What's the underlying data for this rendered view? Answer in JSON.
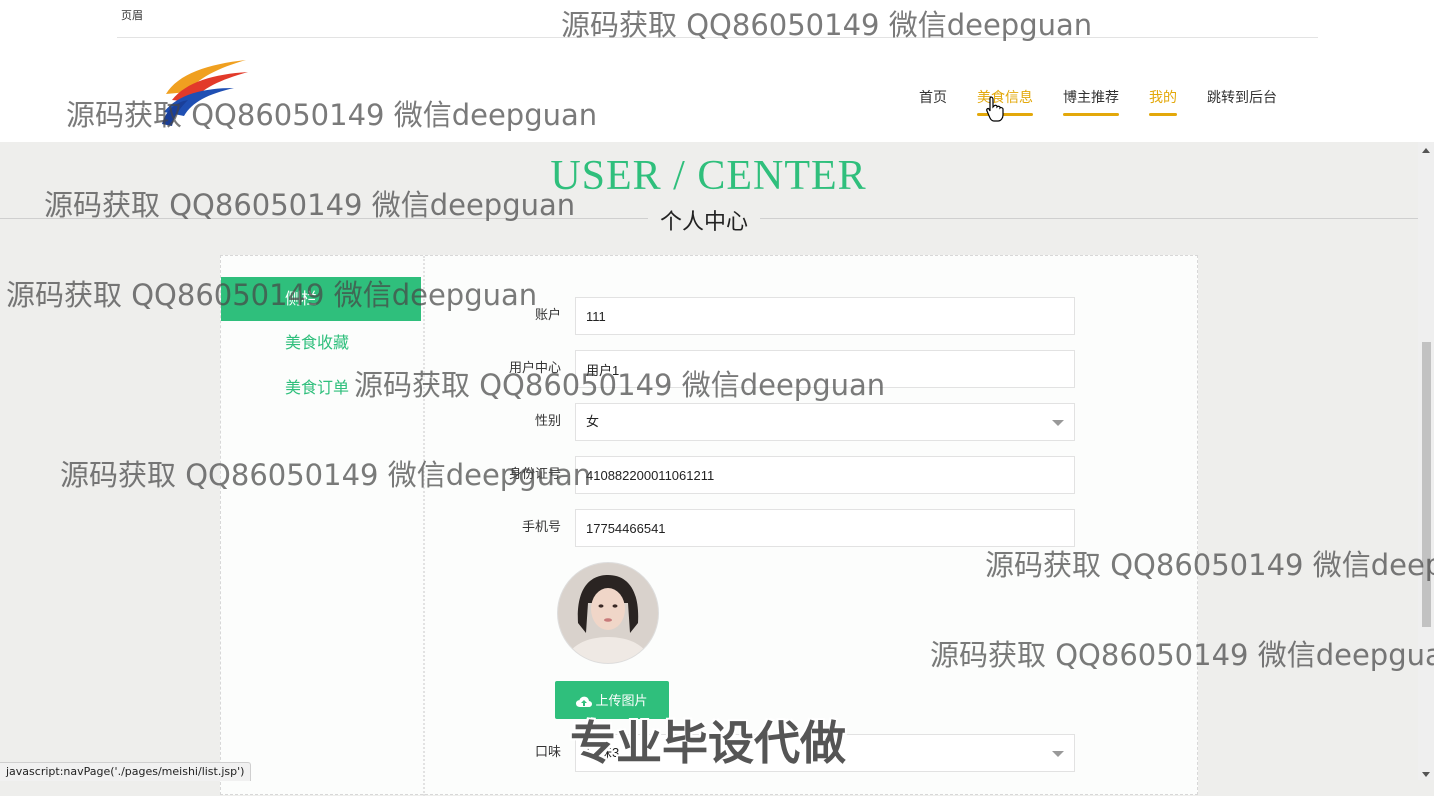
{
  "header": {
    "welcome_text": "页眉",
    "nav": [
      {
        "label": "首页"
      },
      {
        "label": "美食信息"
      },
      {
        "label": "博主推荐"
      },
      {
        "label": "我的"
      },
      {
        "label": "跳转到后台"
      }
    ],
    "accent_color": "#e3a80a"
  },
  "page": {
    "title_en": "USER / CENTER",
    "title_cn": "个人中心",
    "primary_color": "#2fbf7c"
  },
  "sidebar": {
    "items": [
      {
        "label": "侧栏"
      },
      {
        "label": "美食收藏"
      },
      {
        "label": "美食订单"
      }
    ]
  },
  "form": {
    "account": {
      "label": "账户",
      "value": "111"
    },
    "name": {
      "label": "用户中心",
      "value": "用户1"
    },
    "gender": {
      "label": "性别",
      "value": "女"
    },
    "id_card": {
      "label": "身份证号",
      "value": "410882200011061211"
    },
    "phone": {
      "label": "手机号",
      "value": "17754466541"
    },
    "upload_label": "上传图片",
    "taste": {
      "label": "口味",
      "value": "口味3"
    }
  },
  "status_bar": {
    "text": "javascript:navPage('./pages/meishi/list.jsp')"
  },
  "watermarks": {
    "text": "源码获取 QQ86050149 微信deepguan",
    "bold_text": "专业毕设代做"
  }
}
